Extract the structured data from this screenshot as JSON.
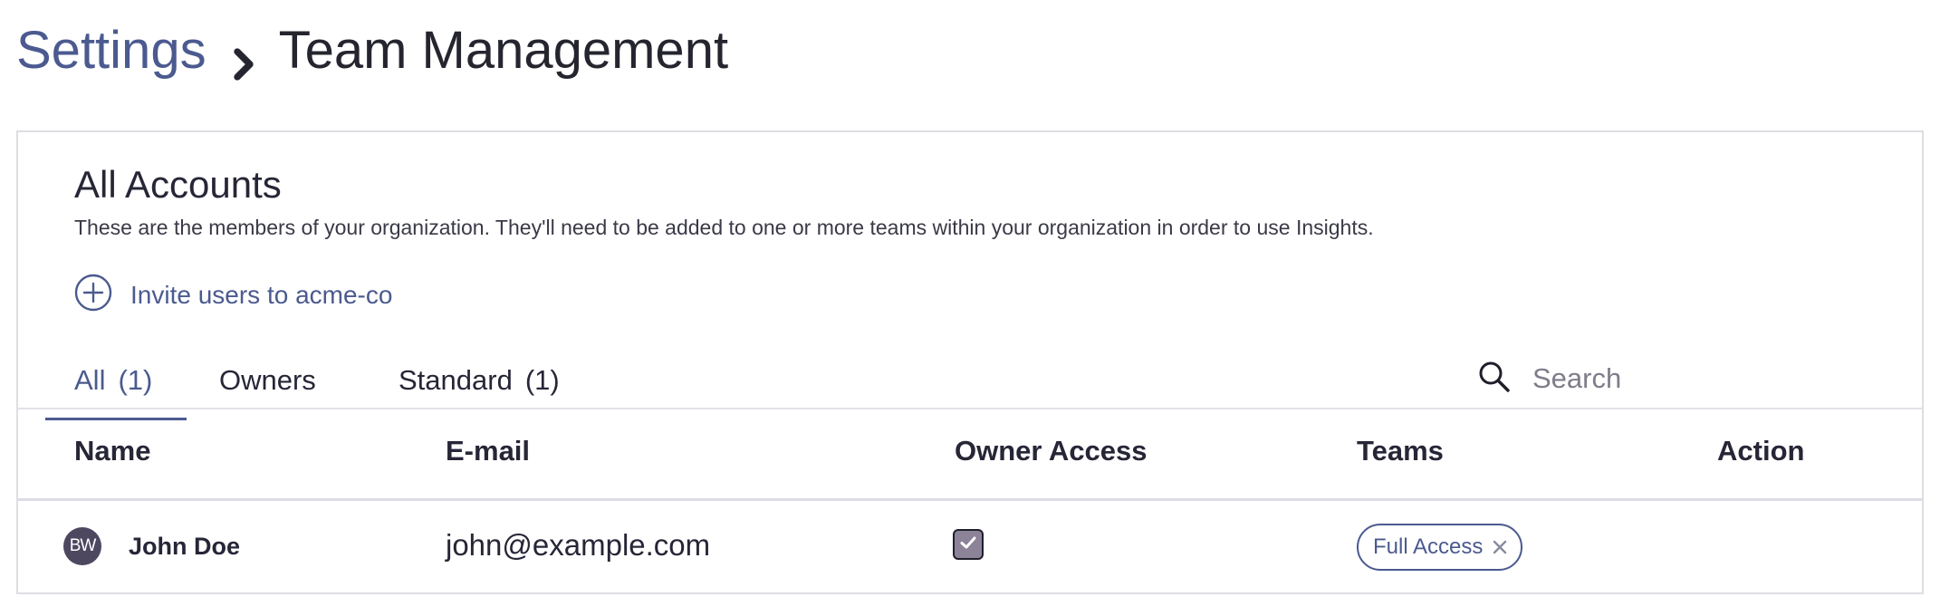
{
  "breadcrumb": {
    "parent": "Settings",
    "separator_icon": "chevron-right-icon",
    "current": "Team Management"
  },
  "panel": {
    "title": "All Accounts",
    "description": "These are the members of your organization. They'll need to be added to one or more teams within your organization in order to use Insights.",
    "invite": {
      "icon": "plus-circle-icon",
      "label": "Invite users to acme-co"
    }
  },
  "tabs": [
    {
      "label": "All",
      "count": "(1)",
      "active": true
    },
    {
      "label": "Owners",
      "count": "",
      "active": false
    },
    {
      "label": "Standard",
      "count": "(1)",
      "active": false
    }
  ],
  "search": {
    "icon": "search-icon",
    "placeholder": "Search",
    "value": ""
  },
  "table": {
    "columns": [
      "Name",
      "E-mail",
      "Owner Access",
      "Teams",
      "Action"
    ],
    "rows": [
      {
        "avatar_initials": "BW",
        "name": "John Doe",
        "email": "john@example.com",
        "owner_access": true,
        "teams": [
          {
            "label": "Full Access",
            "remove_icon": "close-icon"
          }
        ],
        "action": ""
      }
    ]
  },
  "colors": {
    "accent": "#4b5a8f",
    "text": "#262637",
    "border": "#dedee3",
    "avatar_bg": "#4d4760",
    "checkbox_bg": "#8c8399"
  }
}
